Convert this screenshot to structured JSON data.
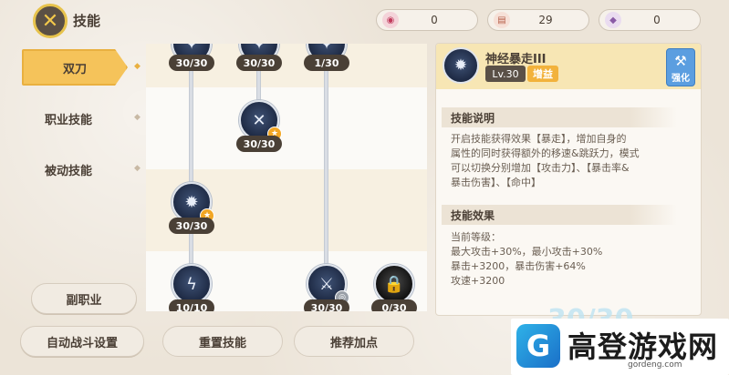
{
  "header": {
    "title": "技能",
    "close_icon": "close-x-icon",
    "currencies": [
      {
        "icon": "gem-icon",
        "value": "0"
      },
      {
        "icon": "scroll-icon",
        "value": "29"
      },
      {
        "icon": "crystal-icon",
        "value": "0"
      }
    ]
  },
  "nav": {
    "tabs": [
      {
        "label": "双刀",
        "active": true
      },
      {
        "label": "职业技能",
        "active": false
      },
      {
        "label": "被动技能",
        "active": false
      }
    ],
    "sub_job_label": "副职业",
    "auto_battle_label": "自动战斗设置"
  },
  "tree": {
    "nodes": [
      {
        "level": "30/30",
        "icon": "skill-icon"
      },
      {
        "level": "30/30",
        "icon": "skill-icon"
      },
      {
        "level": "1/30",
        "icon": "skill-icon"
      },
      {
        "level": "30/30",
        "icon": "cross-blades-icon"
      },
      {
        "level": "30/30",
        "icon": "berserk-icon"
      },
      {
        "level": "10/10",
        "icon": "lightning-icon"
      },
      {
        "level": "30/30",
        "icon": "slash-icon"
      },
      {
        "level": "0/30",
        "icon": "lock-icon"
      }
    ]
  },
  "detail": {
    "skill_name": "神经暴走III",
    "level": "Lv.30",
    "tag": "增益",
    "enhance_label": "强化",
    "description_title": "技能说明",
    "description_lines": [
      "开启技能获得效果【暴走】，增加自身的",
      "属性的同时获得额外的移速&跳跃力，模式",
      "可以切换分别增加【攻击力】、【暴击率&",
      "暴击伤害】、【命中】"
    ],
    "effect_title": "技能效果",
    "effect_lines": [
      "当前等级：",
      "最大攻击+30%，最小攻击+30%",
      "暴击+3200，暴击伤害+64%",
      "攻速+3200"
    ]
  },
  "actions": {
    "reset_label": "重置技能",
    "recommend_label": "推荐加点"
  },
  "watermark": {
    "text": "高登游戏网",
    "url": "gordeng.com",
    "ghost_text": "30/30"
  },
  "colors": {
    "accent": "#f5c35a",
    "enhance": "#5b9ee0",
    "tag": "#f2b23c",
    "node_bg": "#1e2a44"
  }
}
